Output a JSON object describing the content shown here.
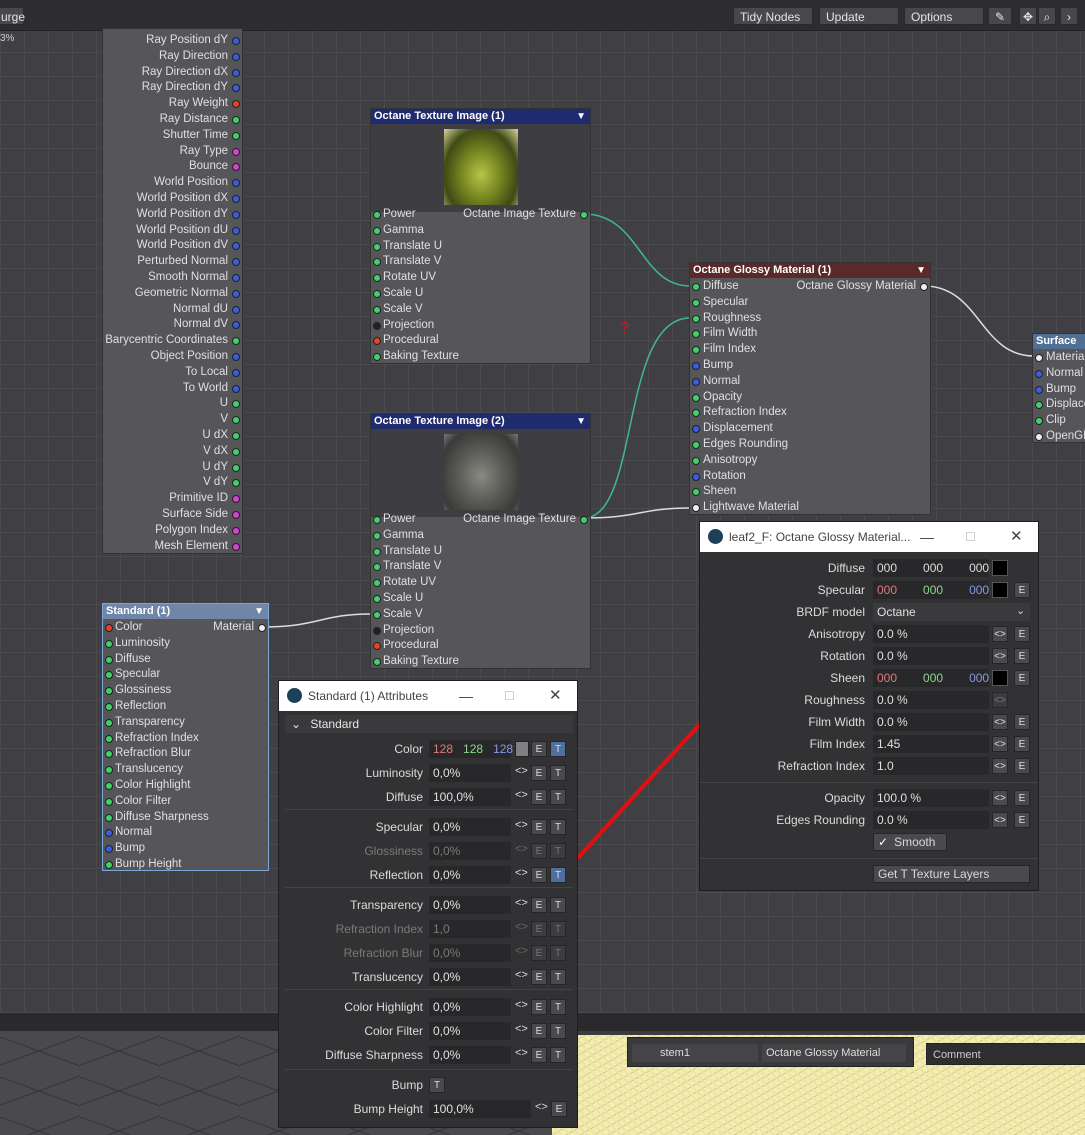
{
  "topbar": {
    "left_label": "urge",
    "tidy": "Tidy Nodes",
    "update": "Update",
    "options": "Options",
    "left_percent": "3%"
  },
  "input_node": {
    "rows": [
      "Ray Position dY",
      "Ray Direction",
      "Ray Direction dX",
      "Ray Direction dY",
      "Ray Weight",
      "Ray Distance",
      "Shutter Time",
      "Ray Type",
      "Bounce",
      "World Position",
      "World Position dX",
      "World Position dY",
      "World Position dU",
      "World Position dV",
      "Perturbed Normal",
      "Smooth Normal",
      "Geometric Normal",
      "Normal dU",
      "Normal dV",
      "Barycentric Coordinates",
      "Object Position",
      "To Local",
      "To World",
      "U",
      "V",
      "U dX",
      "V dX",
      "U dY",
      "V dY",
      "Primitive ID",
      "Surface Side",
      "Polygon Index",
      "Mesh Element"
    ]
  },
  "tex1": {
    "title": "Octane Texture Image (1)",
    "output": "Octane Image Texture",
    "rows": [
      "Power",
      "Gamma",
      "Translate U",
      "Translate V",
      "Rotate UV",
      "Scale U",
      "Scale V",
      "Projection",
      "Procedural",
      "Baking Texture"
    ]
  },
  "tex2": {
    "title": "Octane Texture Image (2)",
    "output": "Octane Image Texture",
    "rows": [
      "Power",
      "Gamma",
      "Translate U",
      "Translate V",
      "Rotate UV",
      "Scale U",
      "Scale V",
      "Projection",
      "Procedural",
      "Baking Texture"
    ]
  },
  "glossy": {
    "title": "Octane Glossy Material (1)",
    "output": "Octane Glossy Material",
    "rows": [
      "Diffuse",
      "Specular",
      "Roughness",
      "Film Width",
      "Film Index",
      "Bump",
      "Normal",
      "Opacity",
      "Refraction Index",
      "Displacement",
      "Edges Rounding",
      "Anisotropy",
      "Rotation",
      "Sheen",
      "Lightwave Material"
    ]
  },
  "surface": {
    "title": "Surface",
    "rows": [
      "Material",
      "Normal",
      "Bump",
      "Displacement",
      "Clip",
      "OpenGL"
    ]
  },
  "standard": {
    "title": "Standard (1)",
    "output": "Material",
    "rows": [
      "Color",
      "Luminosity",
      "Diffuse",
      "Specular",
      "Glossiness",
      "Reflection",
      "Transparency",
      "Refraction Index",
      "Refraction Blur",
      "Translucency",
      "Color Highlight",
      "Color Filter",
      "Diffuse Sharpness",
      "Normal",
      "Bump",
      "Bump Height"
    ]
  },
  "question_mark": "?",
  "std_panel": {
    "title": "Standard (1) Attributes",
    "section": "Standard",
    "color": {
      "label": "Color",
      "r": "128",
      "g": "128",
      "b": "128"
    },
    "rows": [
      {
        "label": "Luminosity",
        "value": "0,0%"
      },
      {
        "label": "Diffuse",
        "value": "100,0%"
      },
      {
        "label": "Specular",
        "value": "0,0%"
      },
      {
        "label": "Glossiness",
        "value": "0,0%"
      },
      {
        "label": "Reflection",
        "value": "0,0%"
      },
      {
        "label": "Transparency",
        "value": "0,0%"
      },
      {
        "label": "Refraction Index",
        "value": "1,0"
      },
      {
        "label": "Refraction Blur",
        "value": "0,0%"
      },
      {
        "label": "Translucency",
        "value": "0,0%"
      },
      {
        "label": "Color Highlight",
        "value": "0,0%"
      },
      {
        "label": "Color Filter",
        "value": "0,0%"
      },
      {
        "label": "Diffuse Sharpness",
        "value": "0,0%"
      }
    ],
    "bump": {
      "label": "Bump"
    },
    "bump_height": {
      "label": "Bump Height",
      "value": "100,0%"
    },
    "e": "E",
    "t": "T",
    "arrows": "<>"
  },
  "gl_panel": {
    "title": "leaf2_F: Octane Glossy Material...",
    "diffuse": {
      "label": "Diffuse",
      "r": "000",
      "g": "000",
      "b": "000"
    },
    "specular": {
      "label": "Specular",
      "r": "000",
      "g": "000",
      "b": "000"
    },
    "brdf": {
      "label": "BRDF model",
      "value": "Octane"
    },
    "anisotropy": {
      "label": "Anisotropy",
      "value": "0.0 %"
    },
    "rotation": {
      "label": "Rotation",
      "value": "0.0 %"
    },
    "sheen": {
      "label": "Sheen",
      "r": "000",
      "g": "000",
      "b": "000"
    },
    "roughness": {
      "label": "Roughness",
      "value": "0.0 %"
    },
    "film_width": {
      "label": "Film Width",
      "value": "0.0 %"
    },
    "film_index": {
      "label": "Film Index",
      "value": "1.45"
    },
    "refraction": {
      "label": "Refraction Index",
      "value": "1.0"
    },
    "opacity": {
      "label": "Opacity",
      "value": "100.0 %"
    },
    "edges": {
      "label": "Edges Rounding",
      "value": "0.0 %"
    },
    "smooth": "Smooth",
    "get_layers": "Get T Texture Layers",
    "e": "E",
    "arrows": "<>"
  },
  "bottom": {
    "surface_name": "stem1",
    "material": "Octane Glossy Material",
    "comment": "Comment"
  },
  "colors": {
    "accent_red": "#e01010",
    "wire_green": "#3fb892",
    "node_blue_header": "#1f2b6e",
    "node_red_header": "#5a2a2a"
  }
}
